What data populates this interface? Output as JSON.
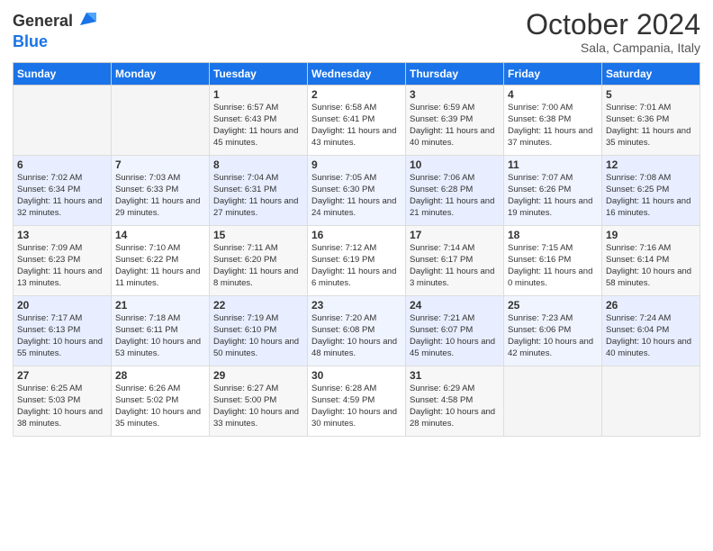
{
  "header": {
    "logo_general": "General",
    "logo_blue": "Blue",
    "month": "October 2024",
    "location": "Sala, Campania, Italy"
  },
  "days_of_week": [
    "Sunday",
    "Monday",
    "Tuesday",
    "Wednesday",
    "Thursday",
    "Friday",
    "Saturday"
  ],
  "weeks": [
    [
      {
        "day": "",
        "sunrise": "",
        "sunset": "",
        "daylight": ""
      },
      {
        "day": "",
        "sunrise": "",
        "sunset": "",
        "daylight": ""
      },
      {
        "day": "1",
        "sunrise": "Sunrise: 6:57 AM",
        "sunset": "Sunset: 6:43 PM",
        "daylight": "Daylight: 11 hours and 45 minutes."
      },
      {
        "day": "2",
        "sunrise": "Sunrise: 6:58 AM",
        "sunset": "Sunset: 6:41 PM",
        "daylight": "Daylight: 11 hours and 43 minutes."
      },
      {
        "day": "3",
        "sunrise": "Sunrise: 6:59 AM",
        "sunset": "Sunset: 6:39 PM",
        "daylight": "Daylight: 11 hours and 40 minutes."
      },
      {
        "day": "4",
        "sunrise": "Sunrise: 7:00 AM",
        "sunset": "Sunset: 6:38 PM",
        "daylight": "Daylight: 11 hours and 37 minutes."
      },
      {
        "day": "5",
        "sunrise": "Sunrise: 7:01 AM",
        "sunset": "Sunset: 6:36 PM",
        "daylight": "Daylight: 11 hours and 35 minutes."
      }
    ],
    [
      {
        "day": "6",
        "sunrise": "Sunrise: 7:02 AM",
        "sunset": "Sunset: 6:34 PM",
        "daylight": "Daylight: 11 hours and 32 minutes."
      },
      {
        "day": "7",
        "sunrise": "Sunrise: 7:03 AM",
        "sunset": "Sunset: 6:33 PM",
        "daylight": "Daylight: 11 hours and 29 minutes."
      },
      {
        "day": "8",
        "sunrise": "Sunrise: 7:04 AM",
        "sunset": "Sunset: 6:31 PM",
        "daylight": "Daylight: 11 hours and 27 minutes."
      },
      {
        "day": "9",
        "sunrise": "Sunrise: 7:05 AM",
        "sunset": "Sunset: 6:30 PM",
        "daylight": "Daylight: 11 hours and 24 minutes."
      },
      {
        "day": "10",
        "sunrise": "Sunrise: 7:06 AM",
        "sunset": "Sunset: 6:28 PM",
        "daylight": "Daylight: 11 hours and 21 minutes."
      },
      {
        "day": "11",
        "sunrise": "Sunrise: 7:07 AM",
        "sunset": "Sunset: 6:26 PM",
        "daylight": "Daylight: 11 hours and 19 minutes."
      },
      {
        "day": "12",
        "sunrise": "Sunrise: 7:08 AM",
        "sunset": "Sunset: 6:25 PM",
        "daylight": "Daylight: 11 hours and 16 minutes."
      }
    ],
    [
      {
        "day": "13",
        "sunrise": "Sunrise: 7:09 AM",
        "sunset": "Sunset: 6:23 PM",
        "daylight": "Daylight: 11 hours and 13 minutes."
      },
      {
        "day": "14",
        "sunrise": "Sunrise: 7:10 AM",
        "sunset": "Sunset: 6:22 PM",
        "daylight": "Daylight: 11 hours and 11 minutes."
      },
      {
        "day": "15",
        "sunrise": "Sunrise: 7:11 AM",
        "sunset": "Sunset: 6:20 PM",
        "daylight": "Daylight: 11 hours and 8 minutes."
      },
      {
        "day": "16",
        "sunrise": "Sunrise: 7:12 AM",
        "sunset": "Sunset: 6:19 PM",
        "daylight": "Daylight: 11 hours and 6 minutes."
      },
      {
        "day": "17",
        "sunrise": "Sunrise: 7:14 AM",
        "sunset": "Sunset: 6:17 PM",
        "daylight": "Daylight: 11 hours and 3 minutes."
      },
      {
        "day": "18",
        "sunrise": "Sunrise: 7:15 AM",
        "sunset": "Sunset: 6:16 PM",
        "daylight": "Daylight: 11 hours and 0 minutes."
      },
      {
        "day": "19",
        "sunrise": "Sunrise: 7:16 AM",
        "sunset": "Sunset: 6:14 PM",
        "daylight": "Daylight: 10 hours and 58 minutes."
      }
    ],
    [
      {
        "day": "20",
        "sunrise": "Sunrise: 7:17 AM",
        "sunset": "Sunset: 6:13 PM",
        "daylight": "Daylight: 10 hours and 55 minutes."
      },
      {
        "day": "21",
        "sunrise": "Sunrise: 7:18 AM",
        "sunset": "Sunset: 6:11 PM",
        "daylight": "Daylight: 10 hours and 53 minutes."
      },
      {
        "day": "22",
        "sunrise": "Sunrise: 7:19 AM",
        "sunset": "Sunset: 6:10 PM",
        "daylight": "Daylight: 10 hours and 50 minutes."
      },
      {
        "day": "23",
        "sunrise": "Sunrise: 7:20 AM",
        "sunset": "Sunset: 6:08 PM",
        "daylight": "Daylight: 10 hours and 48 minutes."
      },
      {
        "day": "24",
        "sunrise": "Sunrise: 7:21 AM",
        "sunset": "Sunset: 6:07 PM",
        "daylight": "Daylight: 10 hours and 45 minutes."
      },
      {
        "day": "25",
        "sunrise": "Sunrise: 7:23 AM",
        "sunset": "Sunset: 6:06 PM",
        "daylight": "Daylight: 10 hours and 42 minutes."
      },
      {
        "day": "26",
        "sunrise": "Sunrise: 7:24 AM",
        "sunset": "Sunset: 6:04 PM",
        "daylight": "Daylight: 10 hours and 40 minutes."
      }
    ],
    [
      {
        "day": "27",
        "sunrise": "Sunrise: 6:25 AM",
        "sunset": "Sunset: 5:03 PM",
        "daylight": "Daylight: 10 hours and 38 minutes."
      },
      {
        "day": "28",
        "sunrise": "Sunrise: 6:26 AM",
        "sunset": "Sunset: 5:02 PM",
        "daylight": "Daylight: 10 hours and 35 minutes."
      },
      {
        "day": "29",
        "sunrise": "Sunrise: 6:27 AM",
        "sunset": "Sunset: 5:00 PM",
        "daylight": "Daylight: 10 hours and 33 minutes."
      },
      {
        "day": "30",
        "sunrise": "Sunrise: 6:28 AM",
        "sunset": "Sunset: 4:59 PM",
        "daylight": "Daylight: 10 hours and 30 minutes."
      },
      {
        "day": "31",
        "sunrise": "Sunrise: 6:29 AM",
        "sunset": "Sunset: 4:58 PM",
        "daylight": "Daylight: 10 hours and 28 minutes."
      },
      {
        "day": "",
        "sunrise": "",
        "sunset": "",
        "daylight": ""
      },
      {
        "day": "",
        "sunrise": "",
        "sunset": "",
        "daylight": ""
      }
    ]
  ]
}
